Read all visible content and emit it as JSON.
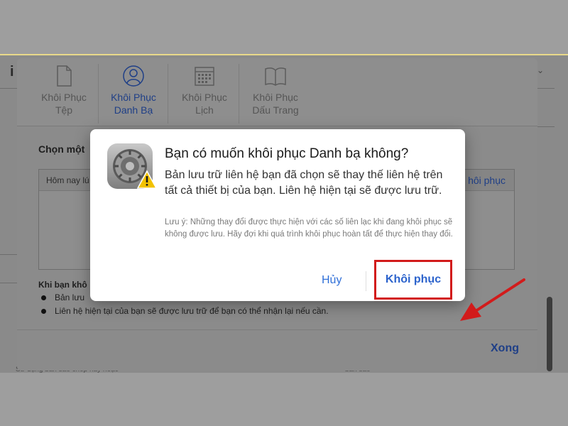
{
  "background": {
    "letter": "i",
    "bottom_left": "Sử dụng bản sao chép này hoặc",
    "bottom_right": "bản sao"
  },
  "tabs": [
    {
      "line1": "Khôi Phục",
      "line2": "Tệp",
      "icon": "document-icon",
      "active": false
    },
    {
      "line1": "Khôi Phục",
      "line2": "Danh Bạ",
      "icon": "contact-icon",
      "active": true
    },
    {
      "line1": "Khôi Phục",
      "line2": "Lịch",
      "icon": "calendar-icon",
      "active": false
    },
    {
      "line1": "Khôi Phục",
      "line2": "Dấu Trang",
      "icon": "book-icon",
      "active": false
    }
  ],
  "main": {
    "choose_label": "Chọn một",
    "table_header_left": "Hôm nay lú",
    "table_header_right": "hôi phục",
    "when_label": "Khi bạn khô",
    "bullets": [
      "Bản lưu",
      "Liên hệ hiện tại của bạn sẽ được lưu trữ để bạn có thể nhận lại nếu cần."
    ],
    "done_label": "Xong"
  },
  "alert": {
    "title": "Bạn có muốn khôi phục Danh bạ không?",
    "message": "Bản lưu trữ liên hệ bạn đã chọn sẽ thay thế liên hệ trên tất cả thiết bị của bạn. Liên hệ hiện tại sẽ được lưu trữ.",
    "note": "Lưu ý: Những thay đổi được thực hiện với các số liên lạc khi đang khôi phục sẽ không được lưu. Hãy đợi khi quá trình khôi phục hoàn tất để thực hiện thay đổi.",
    "cancel_label": "Hủy",
    "confirm_label": "Khôi phục",
    "icon": "settings-gear-icon",
    "warning_icon": "warning-icon"
  },
  "colors": {
    "accent": "#2c63cc",
    "highlight": "#d21b1b",
    "warning": "#f2c200"
  }
}
